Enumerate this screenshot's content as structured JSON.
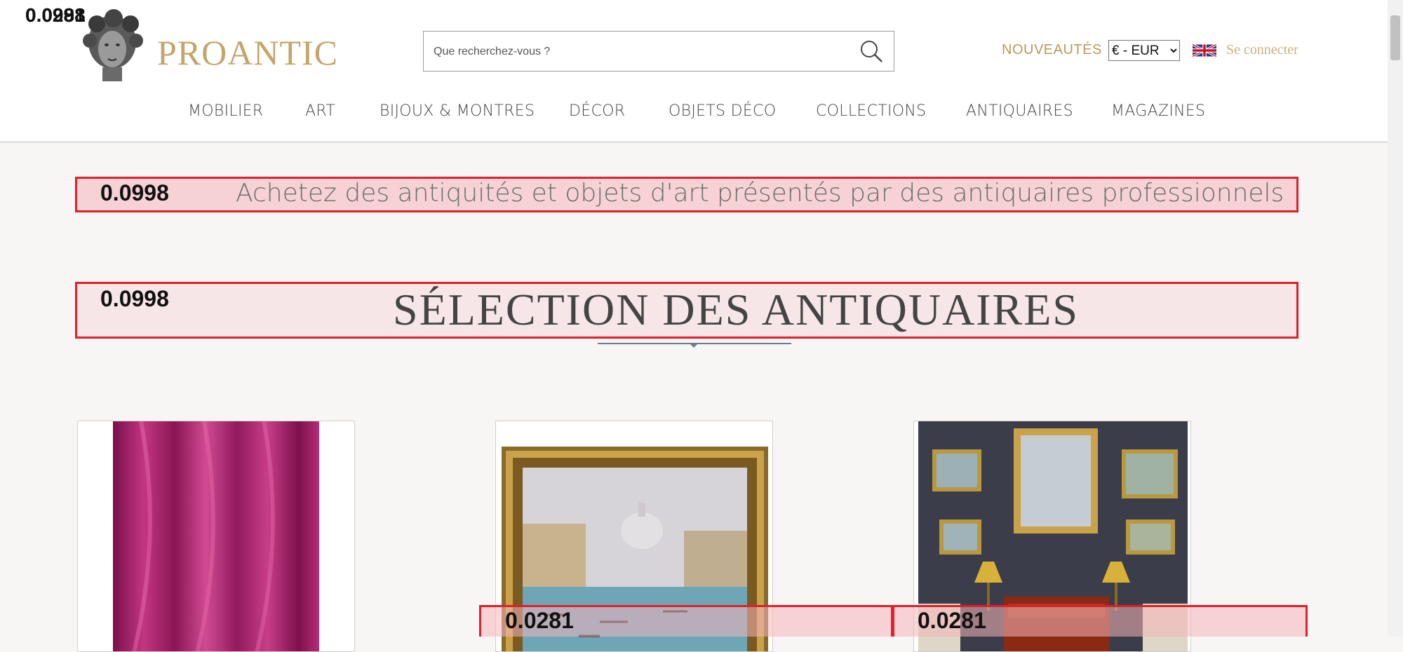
{
  "overlay_scores": {
    "corner": "0.0998",
    "corner_back": "0.0281",
    "tagline": "0.0998",
    "section": "0.0998",
    "card2": "0.0281",
    "card3": "0.0281"
  },
  "header": {
    "logo_text": "PROANTIC",
    "search_placeholder": "Que recherchez-vous ?",
    "new_label": "NOUVEAUTÉS",
    "currency": "€ - EUR",
    "login_label": "Se connecter"
  },
  "nav": {
    "items": [
      "MOBILIER",
      "ART",
      "BIJOUX & MONTRES",
      "DÉCOR",
      "OBJETS DÉCO",
      "COLLECTIONS",
      "ANTIQUAIRES",
      "MAGAZINES"
    ]
  },
  "main": {
    "tagline": "Achetez des antiquités et objets d'art présentés par des antiquaires professionnels",
    "section_title": "SÉLECTION DES ANTIQUAIRES"
  },
  "colors": {
    "gold": "#c4a56a",
    "overlay_red": "#e0202a",
    "text_gray": "#444444"
  }
}
